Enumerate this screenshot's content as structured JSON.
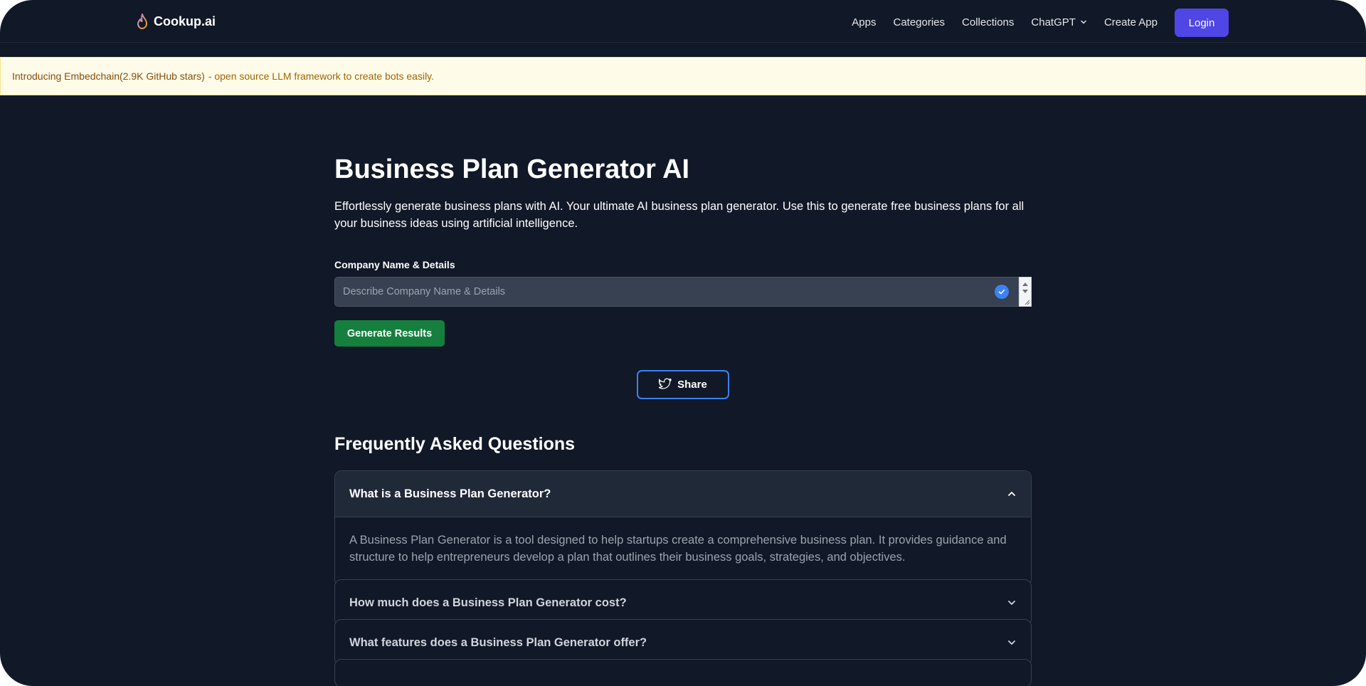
{
  "brand": {
    "name": "Cookup.ai",
    "logo_icon": "flame-logo-icon"
  },
  "nav": {
    "links": [
      {
        "label": "Apps"
      },
      {
        "label": "Categories"
      },
      {
        "label": "Collections"
      },
      {
        "label": "ChatGPT",
        "icon": "chevron-down-icon"
      },
      {
        "label": "Create App"
      }
    ],
    "login_label": "Login"
  },
  "banner": {
    "highlight": "Introducing Embedchain(2.9K GitHub stars)",
    "text": "- open source LLM framework to create bots easily."
  },
  "page": {
    "title": "Business Plan Generator AI",
    "description": "Effortlessly generate business plans with AI. Your ultimate AI business plan generator. Use this to generate free business plans for all your business ideas using artificial intelligence."
  },
  "form": {
    "field_label": "Company Name & Details",
    "input_placeholder": "Describe Company Name & Details",
    "input_value": "",
    "generate_label": "Generate Results"
  },
  "share": {
    "label": "Share",
    "icon": "twitter-bird-icon"
  },
  "faq": {
    "title": "Frequently Asked Questions",
    "items": [
      {
        "question": "What is a Business Plan Generator?",
        "answer": "A Business Plan Generator is a tool designed to help startups create a comprehensive business plan. It provides guidance and structure to help entrepreneurs develop a plan that outlines their business goals, strategies, and objectives.",
        "expanded": true
      },
      {
        "question": "How much does a Business Plan Generator cost?",
        "expanded": false
      },
      {
        "question": "What features does a Business Plan Generator offer?",
        "expanded": false
      }
    ]
  },
  "colors": {
    "background": "#111827",
    "accent": "#4f46e5",
    "generate_button": "#15803d",
    "share_border": "#3b82f6",
    "banner_bg": "#fefce8"
  }
}
